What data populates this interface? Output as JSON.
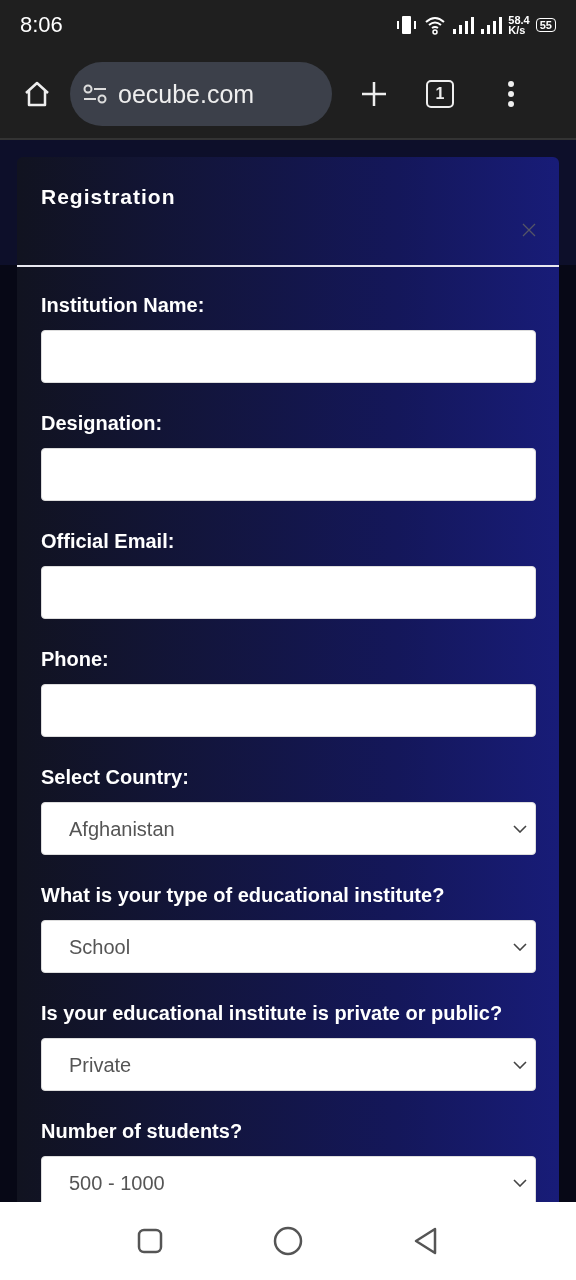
{
  "status_bar": {
    "time": "8:06",
    "net_speed": "58.4",
    "net_unit": "K/s",
    "battery": "55"
  },
  "browser": {
    "url": "oecube.com",
    "tab_count": "1"
  },
  "dialog": {
    "title": "Registration",
    "fields": [
      {
        "label": "Institution Name:",
        "kind": "text"
      },
      {
        "label": "Designation:",
        "kind": "text"
      },
      {
        "label": "Official Email:",
        "kind": "text"
      },
      {
        "label": "Phone:",
        "kind": "text"
      },
      {
        "label": "Select Country:",
        "kind": "select",
        "value": "Afghanistan"
      },
      {
        "label": "What is your type of educational institute?",
        "kind": "select",
        "value": "School"
      },
      {
        "label": "Is your educational institute is private or public?",
        "kind": "select",
        "value": "Private"
      },
      {
        "label": "Number of students?",
        "kind": "select",
        "value": "500 - 1000"
      }
    ]
  }
}
